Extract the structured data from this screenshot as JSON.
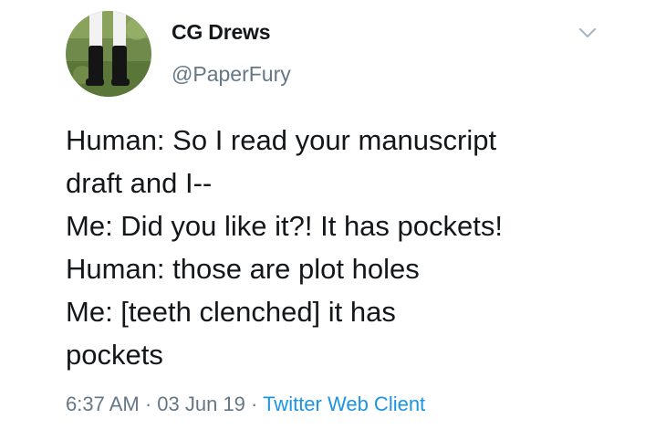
{
  "tweet": {
    "author": {
      "display_name": "CG Drews",
      "handle": "@PaperFury"
    },
    "more_icon": "chevron-down-icon",
    "text_lines": [
      "Human: So I read your manuscript",
      "draft and I--",
      "Me: Did you like it?! It has pockets!",
      "Human: those are plot holes",
      "Me: [teeth clenched] it has",
      "pockets"
    ],
    "meta": {
      "time": "6:37 AM",
      "separator": " · ",
      "date": "03 Jun 19",
      "source": "Twitter Web Client"
    }
  },
  "colors": {
    "text": "#14171a",
    "secondary": "#657786",
    "link": "#1b95e0"
  }
}
